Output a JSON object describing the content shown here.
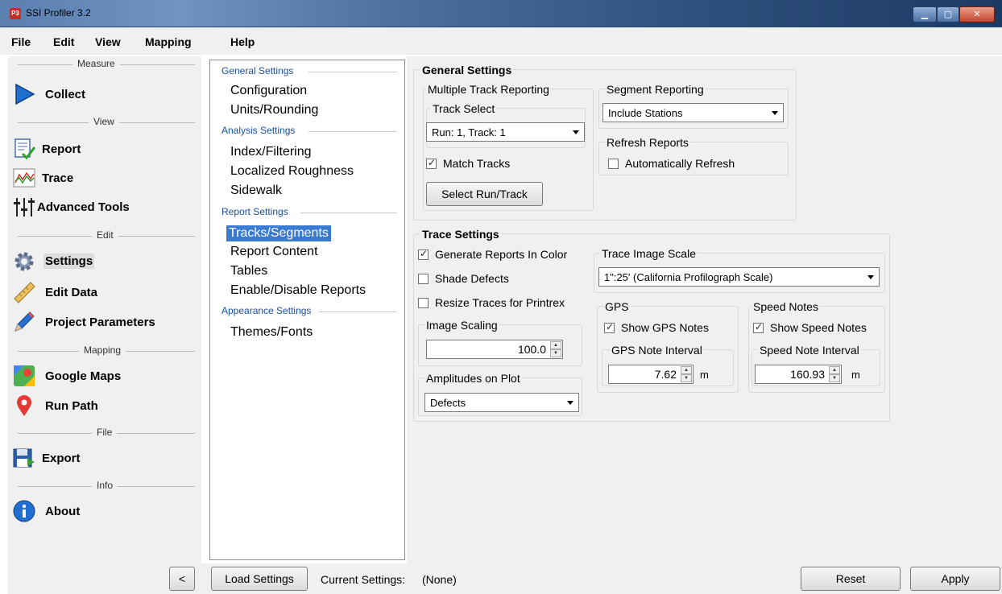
{
  "window": {
    "title": "SSI Profiler 3.2",
    "icon_text": "P3"
  },
  "menu": [
    "File",
    "Edit",
    "View",
    "Mapping",
    "Help"
  ],
  "sidebar": {
    "sections": {
      "measure": "Measure",
      "view": "View",
      "edit": "Edit",
      "mapping": "Mapping",
      "file": "File",
      "info": "Info"
    },
    "items": {
      "collect": "Collect",
      "report": "Report",
      "trace": "Trace",
      "advanced_tools": "Advanced Tools",
      "settings": "Settings",
      "edit_data": "Edit Data",
      "project_parameters": "Project Parameters",
      "google_maps": "Google Maps",
      "run_path": "Run Path",
      "export": "Export",
      "about": "About"
    },
    "collapse_label": "<"
  },
  "settings_list": {
    "groups": {
      "general": "General Settings",
      "analysis": "Analysis Settings",
      "report": "Report Settings",
      "appearance": "Appearance Settings"
    },
    "items": {
      "configuration": "Configuration",
      "units_rounding": "Units/Rounding",
      "index_filtering": "Index/Filtering",
      "localized_roughness": "Localized Roughness",
      "sidewalk": "Sidewalk",
      "tracks_segments": "Tracks/Segments",
      "report_content": "Report Content",
      "tables": "Tables",
      "enable_disable_reports": "Enable/Disable Reports",
      "themes_fonts": "Themes/Fonts"
    },
    "selected": "Tracks/Segments"
  },
  "general_settings": {
    "title": "General Settings",
    "multiple_track_reporting": "Multiple Track Reporting",
    "track_select_label": "Track Select",
    "track_select_value": "Run: 1, Track: 1",
    "match_tracks_label": "Match Tracks",
    "match_tracks_checked": true,
    "select_run_track_button": "Select Run/Track",
    "segment_reporting_label": "Segment Reporting",
    "segment_reporting_value": "Include Stations",
    "refresh_reports_label": "Refresh Reports",
    "auto_refresh_label": "Automatically Refresh",
    "auto_refresh_checked": false
  },
  "trace_settings": {
    "title": "Trace Settings",
    "generate_color_label": "Generate Reports In Color",
    "generate_color_checked": true,
    "shade_defects_label": "Shade Defects",
    "shade_defects_checked": false,
    "resize_traces_label": "Resize Traces for Printrex",
    "resize_traces_checked": false,
    "image_scaling_label": "Image Scaling",
    "image_scaling_value": "100.0",
    "amplitudes_label": "Amplitudes on Plot",
    "amplitudes_value": "Defects",
    "trace_image_scale_label": "Trace Image Scale",
    "trace_image_scale_value": "1\":25' (California Profilograph Scale)",
    "gps": {
      "title": "GPS",
      "show_label": "Show GPS Notes",
      "show_checked": true,
      "interval_label": "GPS Note Interval",
      "interval_value": "7.62",
      "unit": "m"
    },
    "speed": {
      "title": "Speed Notes",
      "show_label": "Show Speed Notes",
      "show_checked": true,
      "interval_label": "Speed Note Interval",
      "interval_value": "160.93",
      "unit": "m"
    }
  },
  "bottom_bar": {
    "load_settings": "Load Settings",
    "current_settings_label": "Current Settings:",
    "current_settings_value": "(None)",
    "reset": "Reset",
    "apply": "Apply"
  }
}
